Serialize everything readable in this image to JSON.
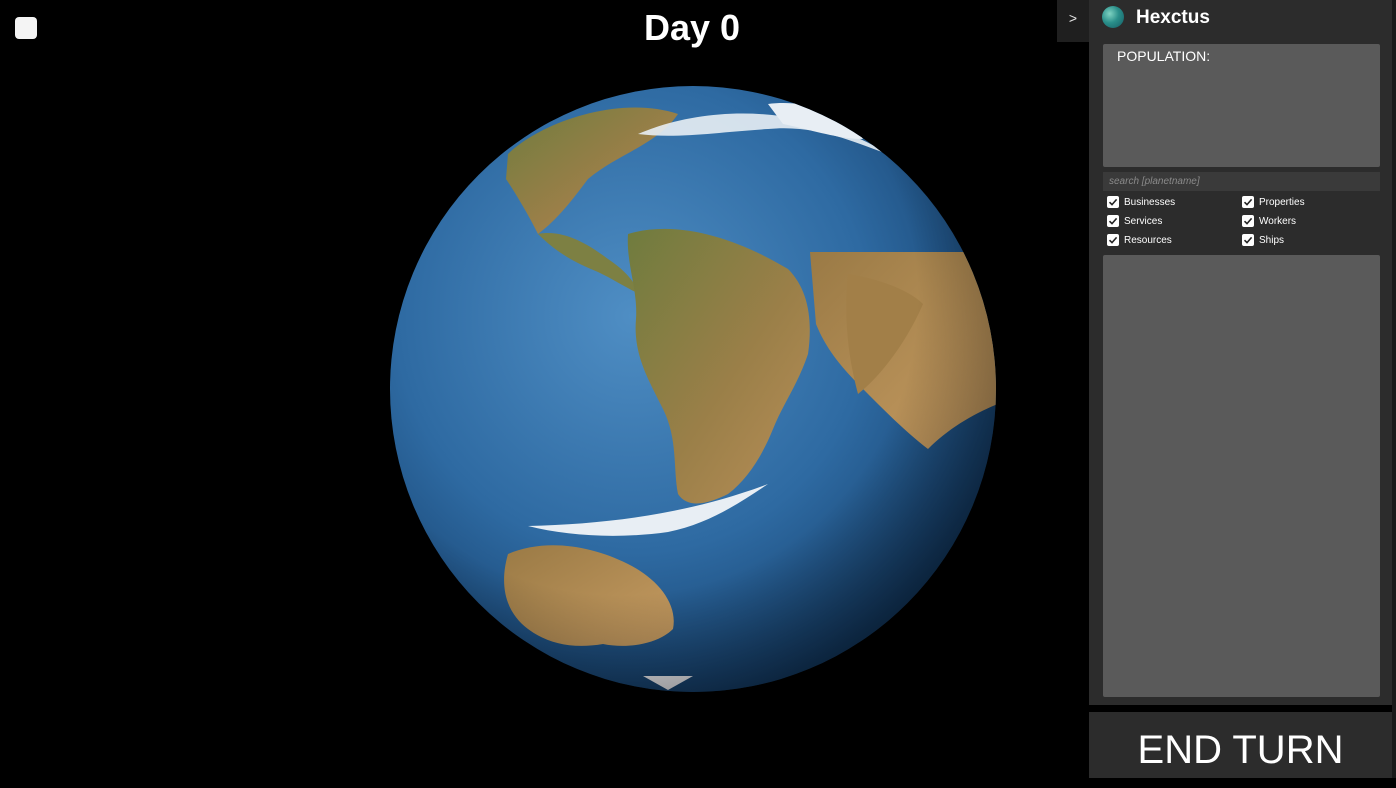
{
  "game": {
    "day_label": "Day 0"
  },
  "panel": {
    "collapse_label": ">",
    "title": "Hexctus",
    "population_label": "POPULATION:",
    "search_placeholder": "search [planetname]",
    "filters": [
      {
        "label": "Businesses",
        "checked": true
      },
      {
        "label": "Properties",
        "checked": true
      },
      {
        "label": "Services",
        "checked": true
      },
      {
        "label": "Workers",
        "checked": true
      },
      {
        "label": "Resources",
        "checked": true
      },
      {
        "label": "Ships",
        "checked": true
      }
    ]
  },
  "actions": {
    "end_turn_label": "END TURN"
  },
  "colors": {
    "ocean": "#2f6fa8",
    "land": "#8c7a45",
    "ice": "#e8eef4",
    "panel_bg": "#2c2c2c",
    "box_bg": "#5a5a5a"
  }
}
